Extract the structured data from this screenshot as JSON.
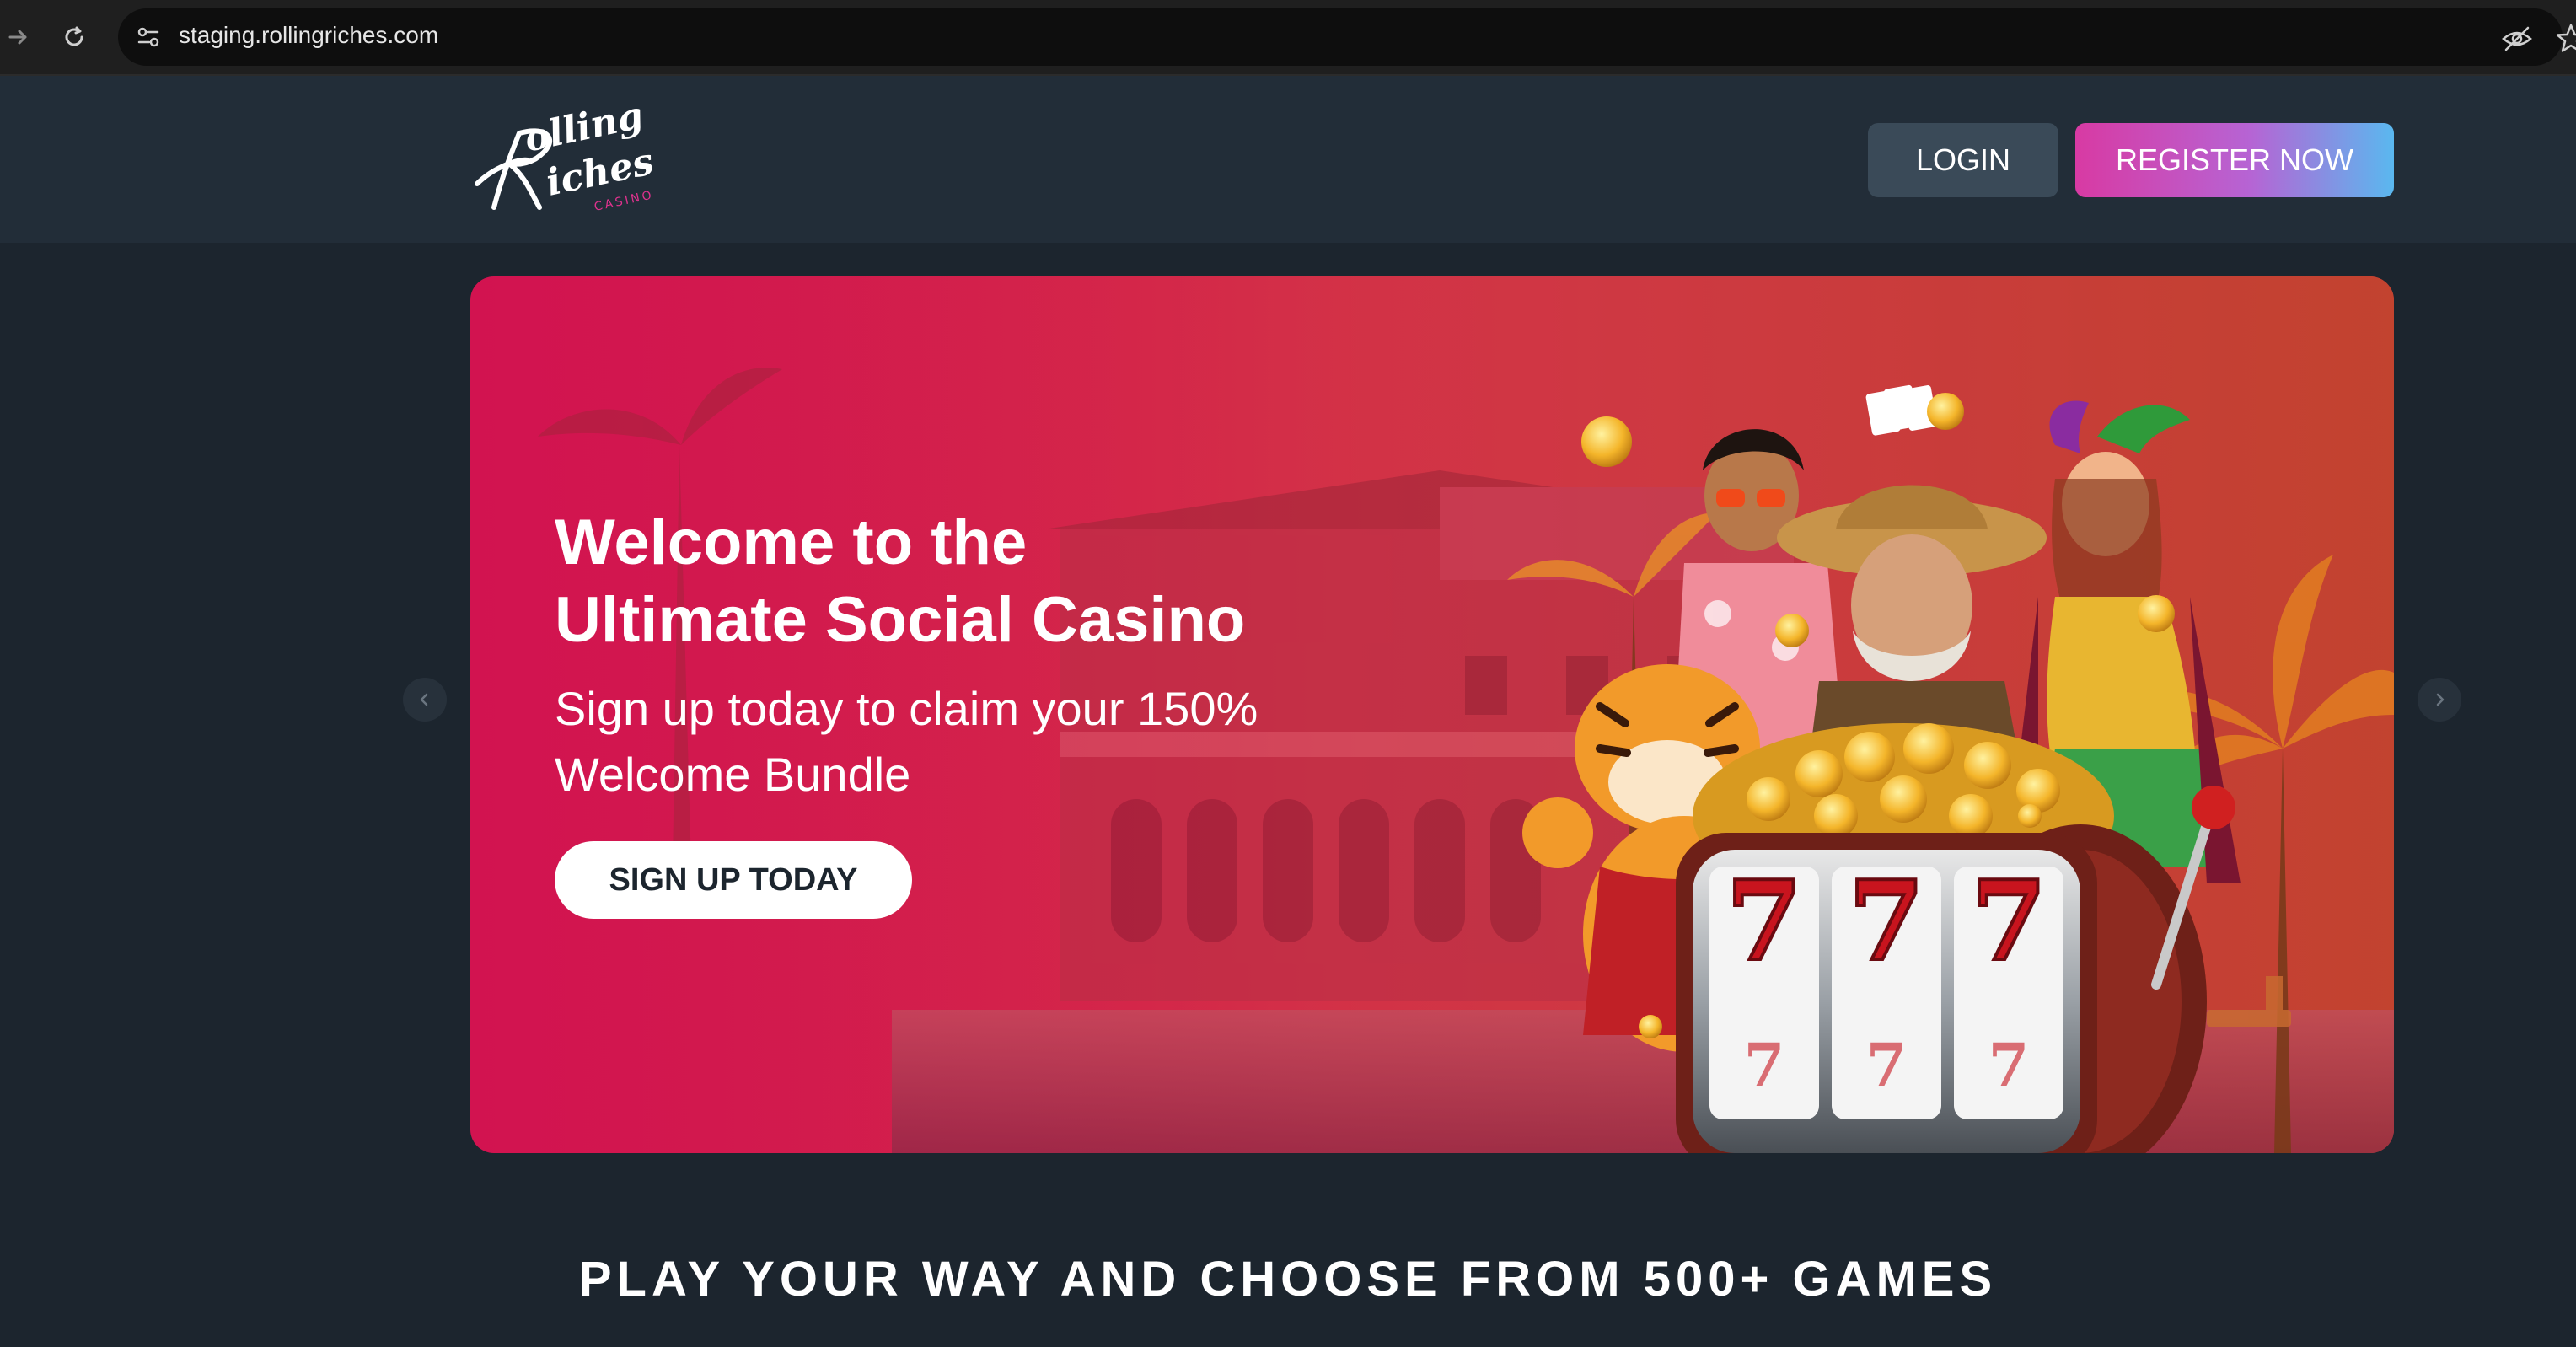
{
  "browser": {
    "url": "staging.rollingriches.com",
    "icons": [
      "forward-icon",
      "reload-icon",
      "site-info-icon",
      "eye-off-icon",
      "star-icon"
    ]
  },
  "header": {
    "logo_text": "Rolling Riches",
    "logo_sub": "CASINO",
    "login_label": "LOGIN",
    "register_label": "REGISTER NOW"
  },
  "hero": {
    "title": "Welcome to the\nUltimate Social Casino",
    "subtitle": "Sign up today to claim your 150%\nWelcome Bundle",
    "cta_label": "SIGN UP TODAY",
    "slot_reels": [
      "7",
      "7",
      "7"
    ]
  },
  "section": {
    "title": "PLAY YOUR WAY AND CHOOSE FROM 500+ GAMES"
  },
  "colors": {
    "page_bg": "#1c252e",
    "header_bg": "#222d38",
    "login_bg": "#3a4a58",
    "register_gradient": [
      "#d83aa3",
      "#5ab8ef"
    ],
    "hero_red": "#d21350"
  }
}
